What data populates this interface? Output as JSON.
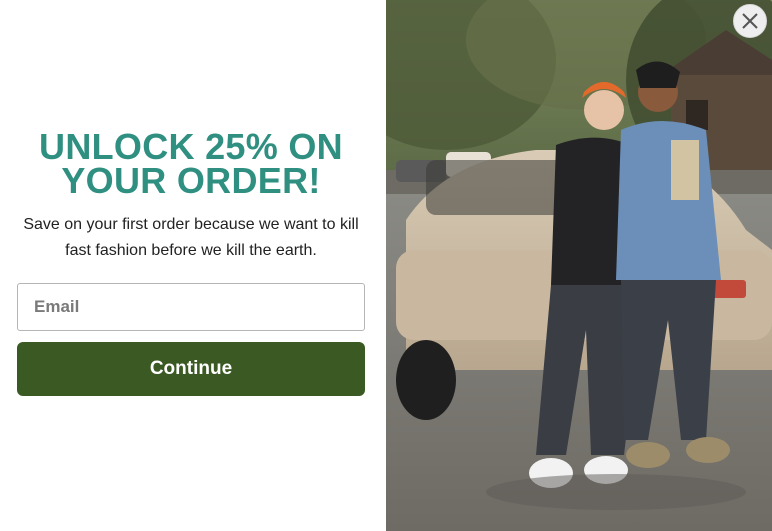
{
  "popup": {
    "headline_line1": "UNLOCK 25% ON",
    "headline_line2": "YOUR ORDER!",
    "subtext": "Save on your first order because we want to kill fast fashion before we kill the earth.",
    "email_placeholder": "Email",
    "continue_label": "Continue",
    "close_icon": "close-icon"
  },
  "colors": {
    "headline": "#2f8f80",
    "button": "#3b5a23",
    "button_text": "#ffffff"
  }
}
